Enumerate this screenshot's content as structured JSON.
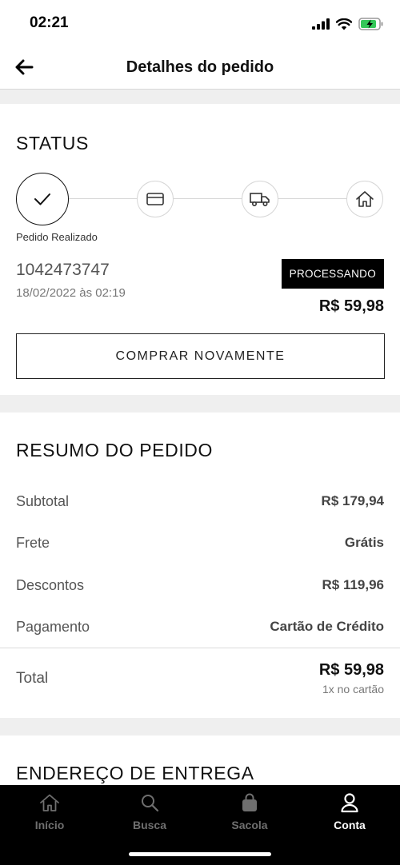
{
  "status_bar": {
    "time": "02:21"
  },
  "header": {
    "title": "Detalhes do pedido"
  },
  "status_section": {
    "title": "STATUS",
    "steps": [
      {
        "icon": "check-icon",
        "label": "Pedido Realizado",
        "active": true
      },
      {
        "icon": "credit-card-icon",
        "active": false
      },
      {
        "icon": "truck-icon",
        "active": false
      },
      {
        "icon": "house-icon",
        "active": false
      }
    ],
    "order_number": "1042473747",
    "order_date": "18/02/2022 às 02:19",
    "status_badge": "PROCESSANDO",
    "total_price": "R$ 59,98",
    "rebuy_label": "COMPRAR NOVAMENTE"
  },
  "summary": {
    "title": "RESUMO DO PEDIDO",
    "rows": [
      {
        "label": "Subtotal",
        "value": "R$ 179,94"
      },
      {
        "label": "Frete",
        "value": "Grátis"
      },
      {
        "label": "Descontos",
        "value": "R$ 119,96"
      },
      {
        "label": "Pagamento",
        "value": "Cartão de Crédito"
      }
    ],
    "total_label": "Total",
    "total_value": "R$ 59,98",
    "installments": "1x no cartão"
  },
  "address": {
    "title": "ENDEREÇO DE ENTREGA"
  },
  "tab_bar": {
    "tabs": [
      {
        "label": "Início",
        "icon": "home-icon",
        "active": false
      },
      {
        "label": "Busca",
        "icon": "search-icon",
        "active": false
      },
      {
        "label": "Sacola",
        "icon": "bag-icon",
        "active": false
      },
      {
        "label": "Conta",
        "icon": "user-icon",
        "active": true
      }
    ]
  },
  "colors": {
    "accent": "#000000",
    "tab_inactive": "#6f6f6f",
    "tab_active": "#ffffff"
  }
}
